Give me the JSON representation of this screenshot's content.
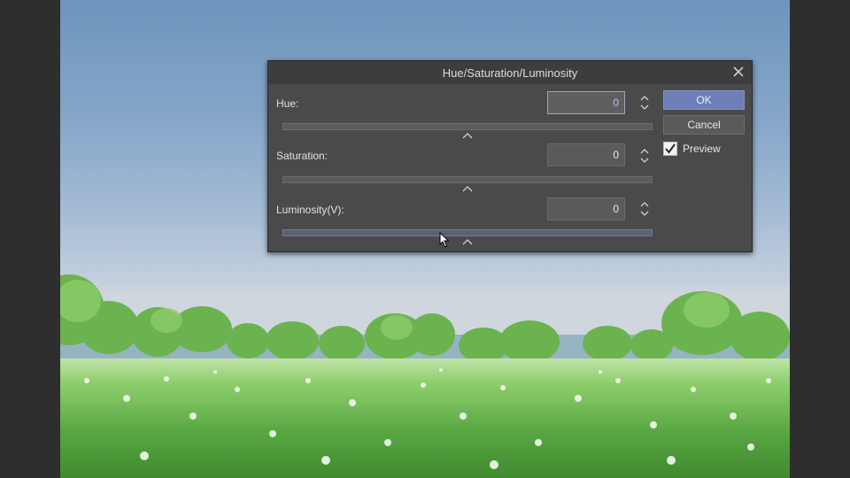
{
  "dialog": {
    "title": "Hue/Saturation/Luminosity",
    "hue": {
      "label": "Hue:",
      "value": "0"
    },
    "saturation": {
      "label": "Saturation:",
      "value": "0"
    },
    "luminosity": {
      "label": "Luminosity(V):",
      "value": "0"
    },
    "ok_label": "OK",
    "cancel_label": "Cancel",
    "preview": {
      "label": "Preview",
      "checked": true
    }
  },
  "colors": {
    "ok_button": "#6c7fb8",
    "dialog_bg": "#4a4a4a",
    "sky_top": "#6e95bd",
    "grass": "#4f9a3c"
  },
  "icons": [
    "close-icon",
    "spin-arrows-icon",
    "slider-caret-icon",
    "checkmark-icon",
    "mouse-cursor-icon"
  ]
}
